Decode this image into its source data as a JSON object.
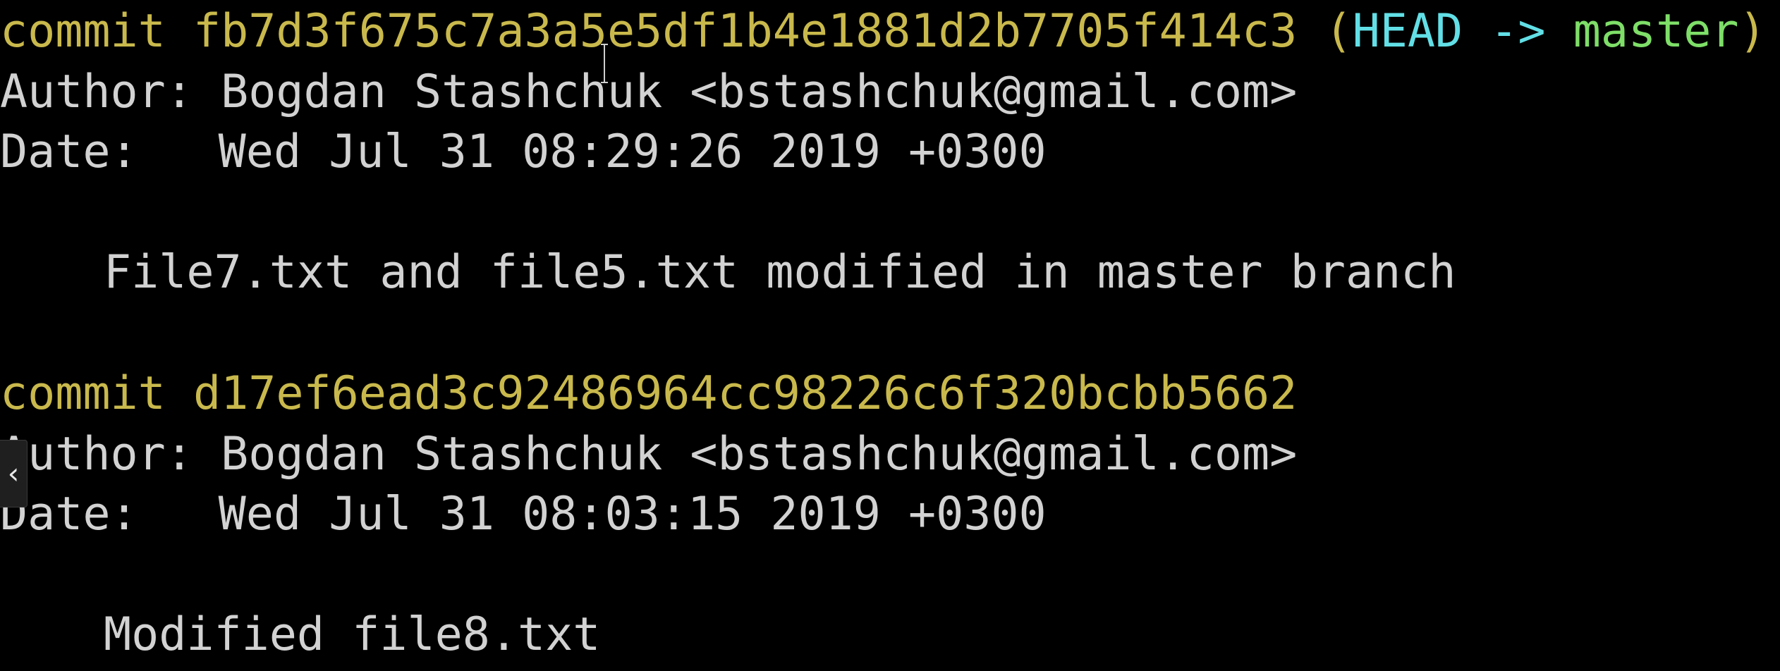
{
  "terminal": {
    "commit1": {
      "keyword": "commit",
      "hash": "fb7d3f675c7a3a5e5df1b4e1881d2b7705f414c3",
      "ref_open": "(",
      "head": "HEAD",
      "arrow": "->",
      "branch": "master",
      "ref_close": ")",
      "author_label": "Author:",
      "author": "Bogdan Stashchuk <bstashchuk@gmail.com>",
      "date_label": "Date:",
      "date": "Wed Jul 31 08:29:26 2019 +0300",
      "message": "File7.txt and file5.txt modified in master branch"
    },
    "commit2": {
      "keyword": "commit",
      "hash": "d17ef6ead3c92486964cc98226c6f320bcbb5662",
      "author_label": "Author:",
      "author": "Bogdan Stashchuk <bstashchuk@gmail.com>",
      "date_label": "Date:",
      "date": "Wed Jul 31 08:03:15 2019 +0300",
      "message": "Modified file8.txt"
    },
    "scroll_tab_glyph": "‹"
  },
  "colors": {
    "background": "#000000",
    "text": "#d2d2d2",
    "commit_hash": "#c9b94c",
    "head": "#62dfe6",
    "branch": "#7ede68"
  },
  "icons": {
    "cursor": "i-beam-cursor-icon",
    "scroll_tab": "chevron-left-icon"
  }
}
